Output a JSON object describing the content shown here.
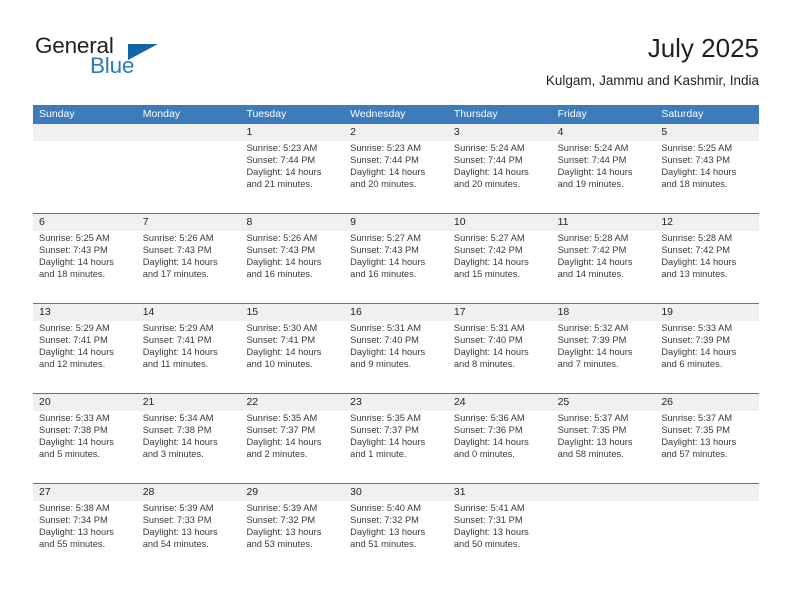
{
  "brand": {
    "name_part1": "General",
    "name_part2": "Blue",
    "triangle_icon": "triangle-icon",
    "color_dark": "#231f20",
    "color_blue": "#2b7cc0"
  },
  "header": {
    "title": "July 2025",
    "subtitle": "Kulgam, Jammu and Kashmir, India"
  },
  "theme": {
    "header_bg": "#3c7cbd",
    "header_text": "#ffffff",
    "band_bg": "#f0f0f0",
    "body_text": "#3b3b3b"
  },
  "weekdays": [
    "Sunday",
    "Monday",
    "Tuesday",
    "Wednesday",
    "Thursday",
    "Friday",
    "Saturday"
  ],
  "weeks": [
    [
      {
        "day": "",
        "sunrise": "",
        "sunset": "",
        "daylight1": "",
        "daylight2": ""
      },
      {
        "day": "",
        "sunrise": "",
        "sunset": "",
        "daylight1": "",
        "daylight2": ""
      },
      {
        "day": "1",
        "sunrise": "Sunrise: 5:23 AM",
        "sunset": "Sunset: 7:44 PM",
        "daylight1": "Daylight: 14 hours",
        "daylight2": "and 21 minutes."
      },
      {
        "day": "2",
        "sunrise": "Sunrise: 5:23 AM",
        "sunset": "Sunset: 7:44 PM",
        "daylight1": "Daylight: 14 hours",
        "daylight2": "and 20 minutes."
      },
      {
        "day": "3",
        "sunrise": "Sunrise: 5:24 AM",
        "sunset": "Sunset: 7:44 PM",
        "daylight1": "Daylight: 14 hours",
        "daylight2": "and 20 minutes."
      },
      {
        "day": "4",
        "sunrise": "Sunrise: 5:24 AM",
        "sunset": "Sunset: 7:44 PM",
        "daylight1": "Daylight: 14 hours",
        "daylight2": "and 19 minutes."
      },
      {
        "day": "5",
        "sunrise": "Sunrise: 5:25 AM",
        "sunset": "Sunset: 7:43 PM",
        "daylight1": "Daylight: 14 hours",
        "daylight2": "and 18 minutes."
      }
    ],
    [
      {
        "day": "6",
        "sunrise": "Sunrise: 5:25 AM",
        "sunset": "Sunset: 7:43 PM",
        "daylight1": "Daylight: 14 hours",
        "daylight2": "and 18 minutes."
      },
      {
        "day": "7",
        "sunrise": "Sunrise: 5:26 AM",
        "sunset": "Sunset: 7:43 PM",
        "daylight1": "Daylight: 14 hours",
        "daylight2": "and 17 minutes."
      },
      {
        "day": "8",
        "sunrise": "Sunrise: 5:26 AM",
        "sunset": "Sunset: 7:43 PM",
        "daylight1": "Daylight: 14 hours",
        "daylight2": "and 16 minutes."
      },
      {
        "day": "9",
        "sunrise": "Sunrise: 5:27 AM",
        "sunset": "Sunset: 7:43 PM",
        "daylight1": "Daylight: 14 hours",
        "daylight2": "and 16 minutes."
      },
      {
        "day": "10",
        "sunrise": "Sunrise: 5:27 AM",
        "sunset": "Sunset: 7:42 PM",
        "daylight1": "Daylight: 14 hours",
        "daylight2": "and 15 minutes."
      },
      {
        "day": "11",
        "sunrise": "Sunrise: 5:28 AM",
        "sunset": "Sunset: 7:42 PM",
        "daylight1": "Daylight: 14 hours",
        "daylight2": "and 14 minutes."
      },
      {
        "day": "12",
        "sunrise": "Sunrise: 5:28 AM",
        "sunset": "Sunset: 7:42 PM",
        "daylight1": "Daylight: 14 hours",
        "daylight2": "and 13 minutes."
      }
    ],
    [
      {
        "day": "13",
        "sunrise": "Sunrise: 5:29 AM",
        "sunset": "Sunset: 7:41 PM",
        "daylight1": "Daylight: 14 hours",
        "daylight2": "and 12 minutes."
      },
      {
        "day": "14",
        "sunrise": "Sunrise: 5:29 AM",
        "sunset": "Sunset: 7:41 PM",
        "daylight1": "Daylight: 14 hours",
        "daylight2": "and 11 minutes."
      },
      {
        "day": "15",
        "sunrise": "Sunrise: 5:30 AM",
        "sunset": "Sunset: 7:41 PM",
        "daylight1": "Daylight: 14 hours",
        "daylight2": "and 10 minutes."
      },
      {
        "day": "16",
        "sunrise": "Sunrise: 5:31 AM",
        "sunset": "Sunset: 7:40 PM",
        "daylight1": "Daylight: 14 hours",
        "daylight2": "and 9 minutes."
      },
      {
        "day": "17",
        "sunrise": "Sunrise: 5:31 AM",
        "sunset": "Sunset: 7:40 PM",
        "daylight1": "Daylight: 14 hours",
        "daylight2": "and 8 minutes."
      },
      {
        "day": "18",
        "sunrise": "Sunrise: 5:32 AM",
        "sunset": "Sunset: 7:39 PM",
        "daylight1": "Daylight: 14 hours",
        "daylight2": "and 7 minutes."
      },
      {
        "day": "19",
        "sunrise": "Sunrise: 5:33 AM",
        "sunset": "Sunset: 7:39 PM",
        "daylight1": "Daylight: 14 hours",
        "daylight2": "and 6 minutes."
      }
    ],
    [
      {
        "day": "20",
        "sunrise": "Sunrise: 5:33 AM",
        "sunset": "Sunset: 7:38 PM",
        "daylight1": "Daylight: 14 hours",
        "daylight2": "and 5 minutes."
      },
      {
        "day": "21",
        "sunrise": "Sunrise: 5:34 AM",
        "sunset": "Sunset: 7:38 PM",
        "daylight1": "Daylight: 14 hours",
        "daylight2": "and 3 minutes."
      },
      {
        "day": "22",
        "sunrise": "Sunrise: 5:35 AM",
        "sunset": "Sunset: 7:37 PM",
        "daylight1": "Daylight: 14 hours",
        "daylight2": "and 2 minutes."
      },
      {
        "day": "23",
        "sunrise": "Sunrise: 5:35 AM",
        "sunset": "Sunset: 7:37 PM",
        "daylight1": "Daylight: 14 hours",
        "daylight2": "and 1 minute."
      },
      {
        "day": "24",
        "sunrise": "Sunrise: 5:36 AM",
        "sunset": "Sunset: 7:36 PM",
        "daylight1": "Daylight: 14 hours",
        "daylight2": "and 0 minutes."
      },
      {
        "day": "25",
        "sunrise": "Sunrise: 5:37 AM",
        "sunset": "Sunset: 7:35 PM",
        "daylight1": "Daylight: 13 hours",
        "daylight2": "and 58 minutes."
      },
      {
        "day": "26",
        "sunrise": "Sunrise: 5:37 AM",
        "sunset": "Sunset: 7:35 PM",
        "daylight1": "Daylight: 13 hours",
        "daylight2": "and 57 minutes."
      }
    ],
    [
      {
        "day": "27",
        "sunrise": "Sunrise: 5:38 AM",
        "sunset": "Sunset: 7:34 PM",
        "daylight1": "Daylight: 13 hours",
        "daylight2": "and 55 minutes."
      },
      {
        "day": "28",
        "sunrise": "Sunrise: 5:39 AM",
        "sunset": "Sunset: 7:33 PM",
        "daylight1": "Daylight: 13 hours",
        "daylight2": "and 54 minutes."
      },
      {
        "day": "29",
        "sunrise": "Sunrise: 5:39 AM",
        "sunset": "Sunset: 7:32 PM",
        "daylight1": "Daylight: 13 hours",
        "daylight2": "and 53 minutes."
      },
      {
        "day": "30",
        "sunrise": "Sunrise: 5:40 AM",
        "sunset": "Sunset: 7:32 PM",
        "daylight1": "Daylight: 13 hours",
        "daylight2": "and 51 minutes."
      },
      {
        "day": "31",
        "sunrise": "Sunrise: 5:41 AM",
        "sunset": "Sunset: 7:31 PM",
        "daylight1": "Daylight: 13 hours",
        "daylight2": "and 50 minutes."
      },
      {
        "day": "",
        "sunrise": "",
        "sunset": "",
        "daylight1": "",
        "daylight2": ""
      },
      {
        "day": "",
        "sunrise": "",
        "sunset": "",
        "daylight1": "",
        "daylight2": ""
      }
    ]
  ]
}
